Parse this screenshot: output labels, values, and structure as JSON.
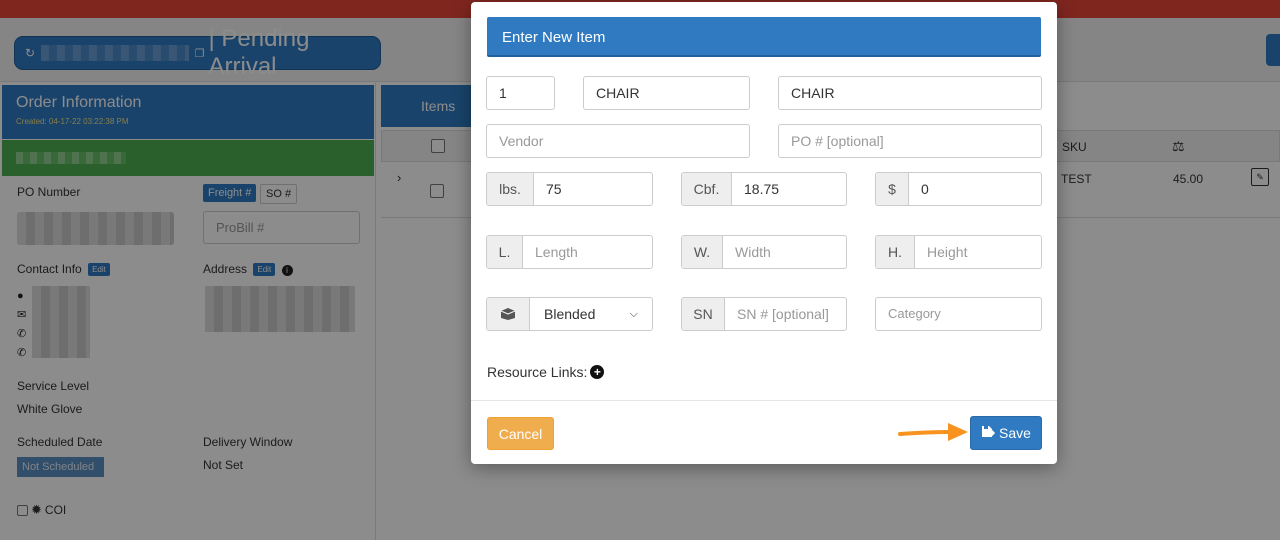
{
  "page": {
    "title": "| Pending Arrival"
  },
  "order": {
    "heading": "Order Information",
    "created": "Created: 04-17-22 03:22:38 PM",
    "po_label": "PO Number",
    "freight_tab": "Freight #",
    "so_tab": "SO #",
    "probill_placeholder": "ProBill #",
    "contact_label": "Contact Info",
    "contact_edit": "Edit",
    "address_label": "Address",
    "address_edit": "Edit",
    "service_level_label": "Service Level",
    "service_level_value": "White Glove",
    "scheduled_label": "Scheduled Date",
    "scheduled_value": "Not Scheduled",
    "delivery_window_label": "Delivery Window",
    "delivery_window_value": "Not Set",
    "coi_label": "COI"
  },
  "items_panel": {
    "tab_label": "Items",
    "col_sku": "SKU",
    "row_sku": "TEST",
    "row_value": "45.00"
  },
  "modal": {
    "title": "Enter New Item",
    "qty": "1",
    "name": "CHAIR",
    "description": "CHAIR",
    "vendor_placeholder": "Vendor",
    "po_placeholder": "PO # [optional]",
    "lbs_label": "lbs.",
    "lbs_value": "75",
    "cbf_label": "Cbf.",
    "cbf_value": "18.75",
    "price_label": "$",
    "price_value": "0",
    "length_label": "L.",
    "length_placeholder": "Length",
    "width_label": "W.",
    "width_placeholder": "Width",
    "height_label": "H.",
    "height_placeholder": "Height",
    "packaging_value": "Blended",
    "sn_label": "SN",
    "sn_placeholder": "SN # [optional]",
    "category_placeholder": "Category",
    "resource_links_label": "Resource Links:",
    "cancel_label": "Cancel",
    "save_label": "Save"
  },
  "colors": {
    "primary": "#2f7ac1",
    "warning": "#f0ad4e",
    "success": "#4caf50",
    "arrow": "#f7931e"
  }
}
